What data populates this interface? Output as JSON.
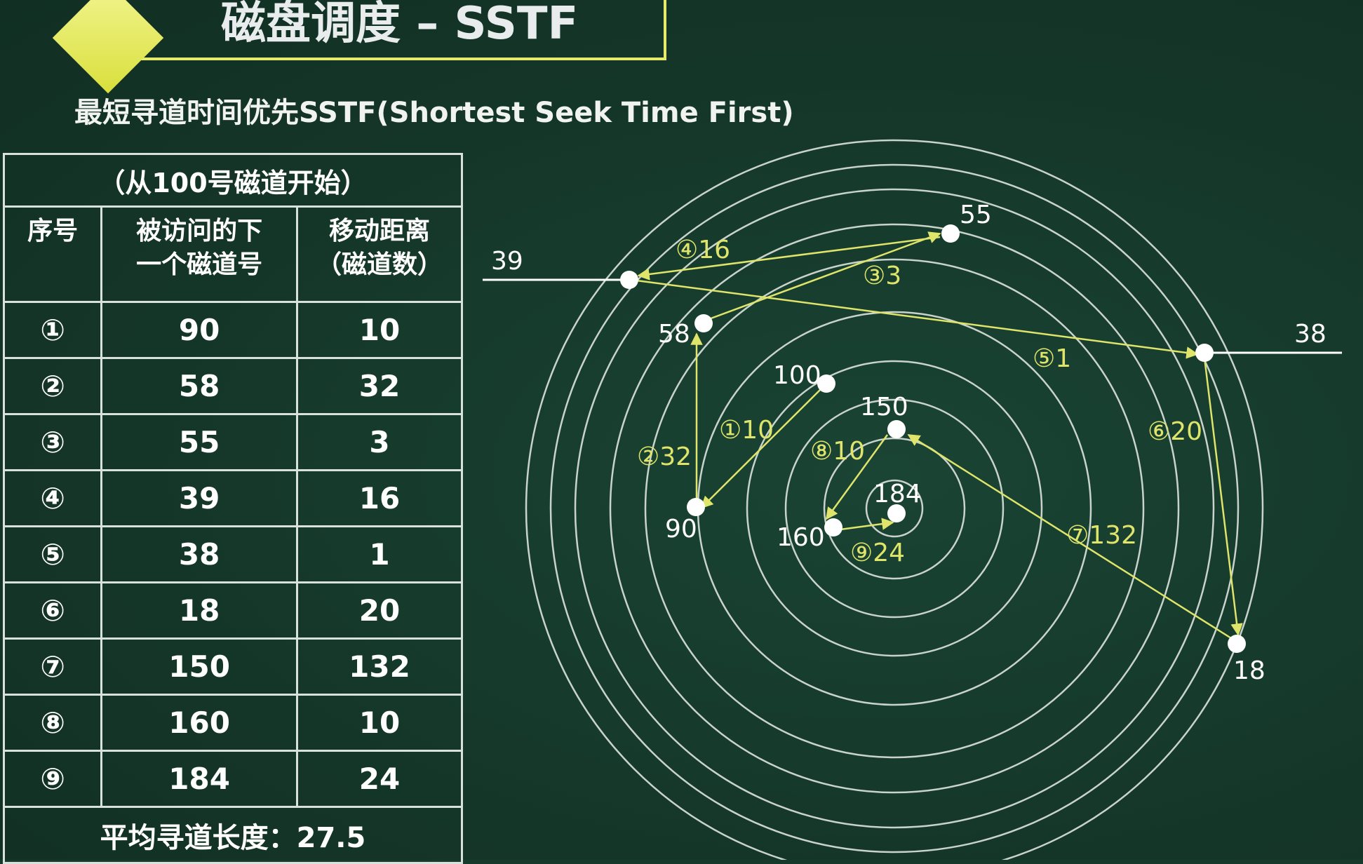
{
  "title": "磁盘调度 – SSTF",
  "subtitle": "最短寻道时间优先SSTF(Shortest Seek Time First)",
  "table": {
    "caption": "（从100号磁道开始）",
    "headers": {
      "col1": "序号",
      "col2_line1": "被访问的下",
      "col2_line2": "一个磁道号",
      "col3_line1": "移动距离",
      "col3_line2": "（磁道数）"
    },
    "rows": [
      {
        "seq": "①",
        "track": "90",
        "distance": "10"
      },
      {
        "seq": "②",
        "track": "58",
        "distance": "32"
      },
      {
        "seq": "③",
        "track": "55",
        "distance": "3"
      },
      {
        "seq": "④",
        "track": "39",
        "distance": "16"
      },
      {
        "seq": "⑤",
        "track": "38",
        "distance": "1"
      },
      {
        "seq": "⑥",
        "track": "18",
        "distance": "20"
      },
      {
        "seq": "⑦",
        "track": "150",
        "distance": "132"
      },
      {
        "seq": "⑧",
        "track": "160",
        "distance": "10"
      },
      {
        "seq": "⑨",
        "track": "184",
        "distance": "24"
      }
    ],
    "footer": "平均寻道长度：27.5"
  },
  "diagram": {
    "start_track": "100",
    "track_labels": {
      "t55": "55",
      "t39": "39",
      "t58": "58",
      "t38": "38",
      "t100": "100",
      "t150": "150",
      "t184": "184",
      "t160": "160",
      "t90": "90",
      "t18": "18"
    },
    "step_labels": {
      "s1": "①10",
      "s2": "②32",
      "s3": "③3",
      "s4": "④16",
      "s5": "⑤1",
      "s6": "⑥20",
      "s7": "⑦132",
      "s8": "⑧10",
      "s9": "⑨24"
    },
    "colors": {
      "background": "#163a2c",
      "arrow": "#dfe46a",
      "track_circle": "#c9d3cc",
      "point": "#ffffff"
    }
  }
}
